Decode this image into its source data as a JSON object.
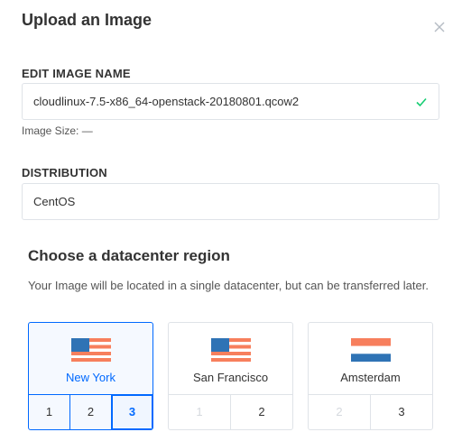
{
  "dialog": {
    "title": "Upload an Image",
    "close_icon": "close-icon"
  },
  "image_name": {
    "label": "EDIT IMAGE NAME",
    "value": "cloudlinux-7.5-x86_64-openstack-20180801.qcow2",
    "valid_icon": "check-icon",
    "size_text": "Image Size: —"
  },
  "distribution": {
    "label": "DISTRIBUTION",
    "value": "CentOS"
  },
  "region": {
    "title": "Choose a datacenter region",
    "description": "Your Image will be located in a single datacenter, but can be transferred later.",
    "options": [
      {
        "name": "New York",
        "flag": "us-flag-icon",
        "selected": true,
        "datacenters": [
          {
            "label": "1",
            "enabled": true,
            "active": false
          },
          {
            "label": "2",
            "enabled": true,
            "active": false
          },
          {
            "label": "3",
            "enabled": true,
            "active": true
          }
        ]
      },
      {
        "name": "San Francisco",
        "flag": "us-flag-icon",
        "selected": false,
        "datacenters": [
          {
            "label": "1",
            "enabled": false,
            "active": false
          },
          {
            "label": "2",
            "enabled": true,
            "active": false
          }
        ]
      },
      {
        "name": "Amsterdam",
        "flag": "netherlands-flag-icon",
        "selected": false,
        "datacenters": [
          {
            "label": "2",
            "enabled": false,
            "active": false
          },
          {
            "label": "3",
            "enabled": true,
            "active": false
          }
        ]
      }
    ]
  },
  "colors": {
    "accent": "#0069ff",
    "valid": "#15cd72",
    "border": "#dfe3e8",
    "flag_red": "#f77f5d",
    "flag_blue": "#2f73b5"
  }
}
